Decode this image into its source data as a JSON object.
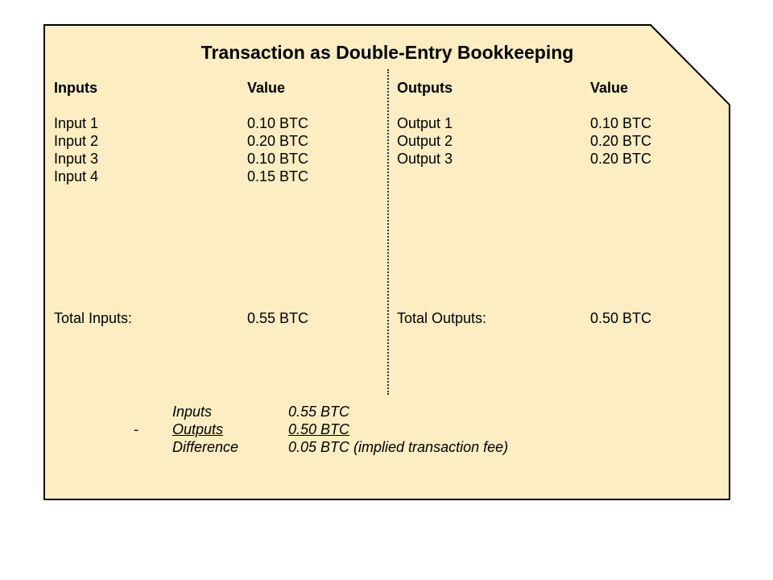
{
  "card": {
    "fill": "#fdedc2",
    "stroke": "#000000"
  },
  "title": "Transaction as Double-Entry Bookkeeping",
  "inputs": {
    "header": "Inputs",
    "value_header": "Value",
    "rows": [
      {
        "label": "Input 1",
        "value": "0.10  BTC"
      },
      {
        "label": "Input 2",
        "value": "0.20  BTC"
      },
      {
        "label": "Input 3",
        "value": "0.10  BTC"
      },
      {
        "label": "Input 4",
        "value": "0.15  BTC"
      }
    ],
    "total_label": "Total Inputs:",
    "total_value": "0.55 BTC"
  },
  "outputs": {
    "header": "Outputs",
    "value_header": "Value",
    "rows": [
      {
        "label": "Output 1",
        "value": "0.10  BTC"
      },
      {
        "label": "Output 2",
        "value": "0.20  BTC"
      },
      {
        "label": "Output 3",
        "value": "0.20  BTC"
      }
    ],
    "total_label": "Total Outputs:",
    "total_value": "0.50  BTC"
  },
  "summary": {
    "minus_sign": "-",
    "inputs_label": "Inputs",
    "inputs_value": "0.55 BTC",
    "outputs_label": "Outputs",
    "outputs_value": "0.50 BTC",
    "difference_label": "Difference",
    "difference_value": "0.05 BTC (implied transaction fee)"
  }
}
